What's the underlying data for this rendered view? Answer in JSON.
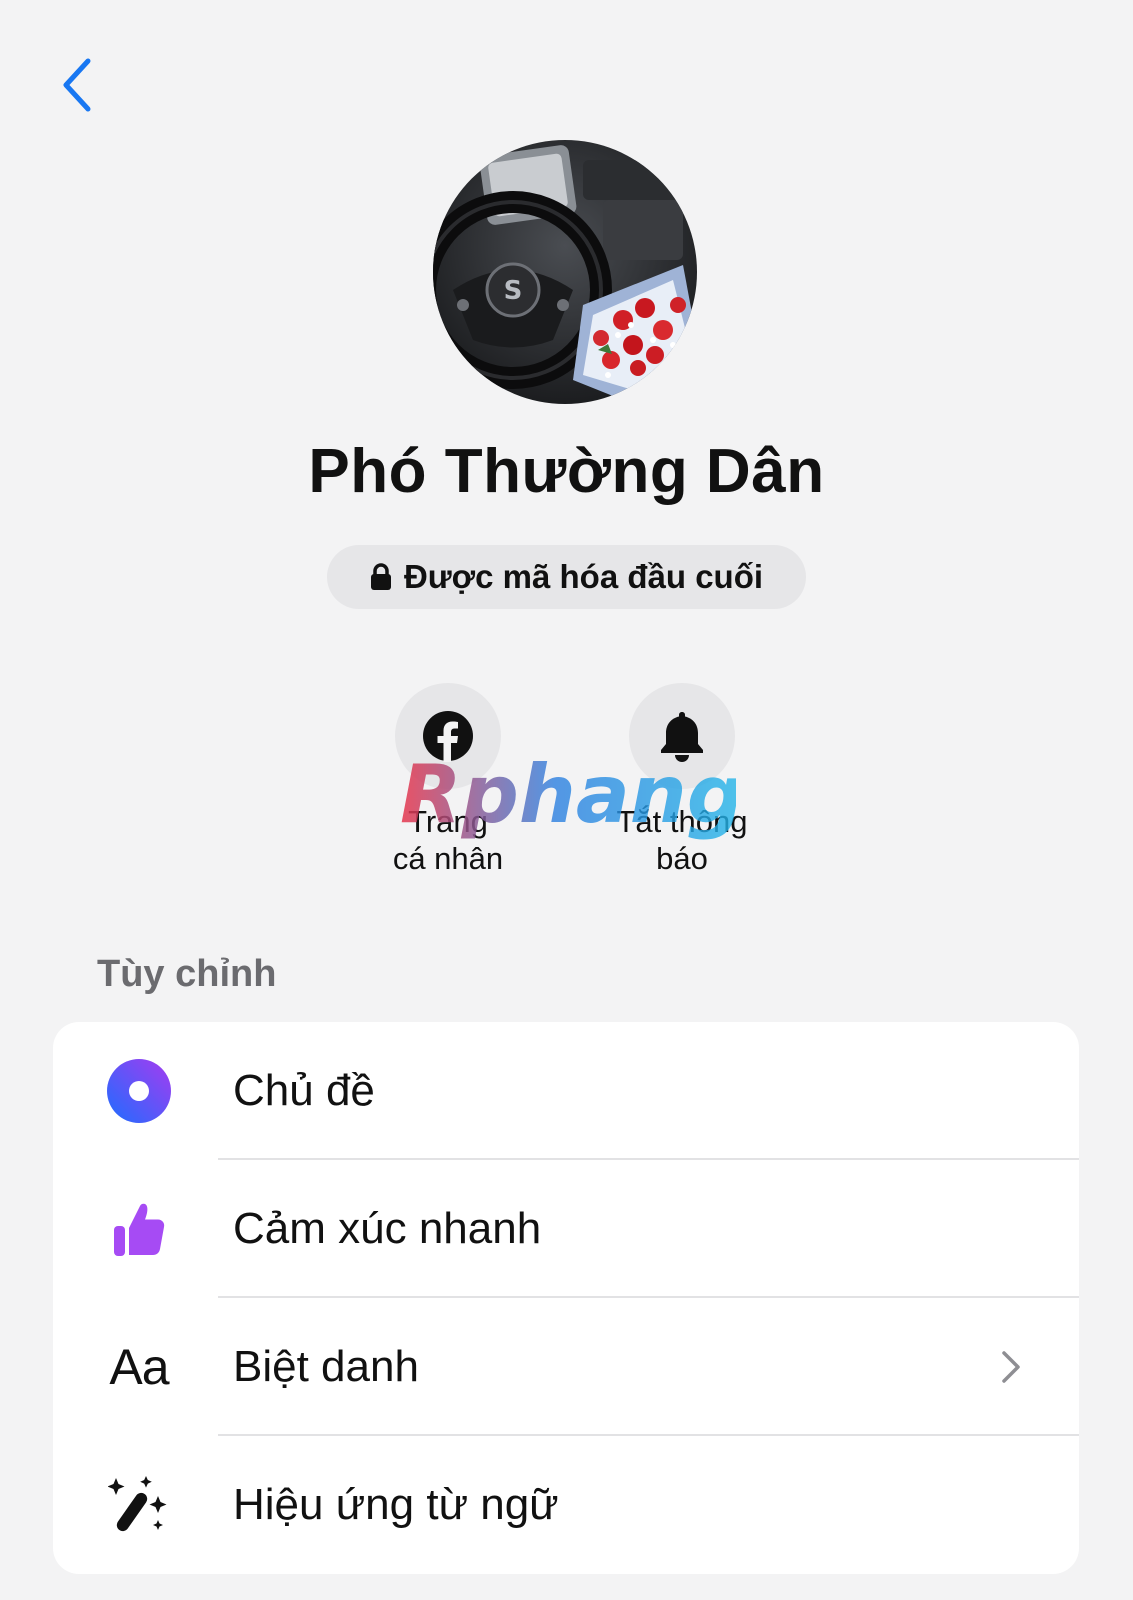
{
  "header": {
    "back_icon": "chevron-left-icon",
    "accent": "#1877f2"
  },
  "profile": {
    "name": "Phó Thường Dân",
    "encryption_label": "Được mã hóa đầu cuối"
  },
  "actions": [
    {
      "icon": "facebook-icon",
      "line1": "Trang",
      "line2": "cá nhân"
    },
    {
      "icon": "bell-icon",
      "line1": "Tắt thông",
      "line2": "báo"
    }
  ],
  "watermark": "Rphang",
  "customize": {
    "title": "Tùy chỉnh",
    "items": [
      {
        "icon": "theme-icon",
        "label": "Chủ đề"
      },
      {
        "icon": "thumbs-up-icon",
        "label": "Cảm xúc nhanh"
      },
      {
        "icon": "text-aa-icon",
        "icon_text": "Aa",
        "label": "Biệt danh"
      },
      {
        "icon": "magic-wand-icon",
        "label": "Hiệu ứng từ ngữ"
      }
    ]
  }
}
